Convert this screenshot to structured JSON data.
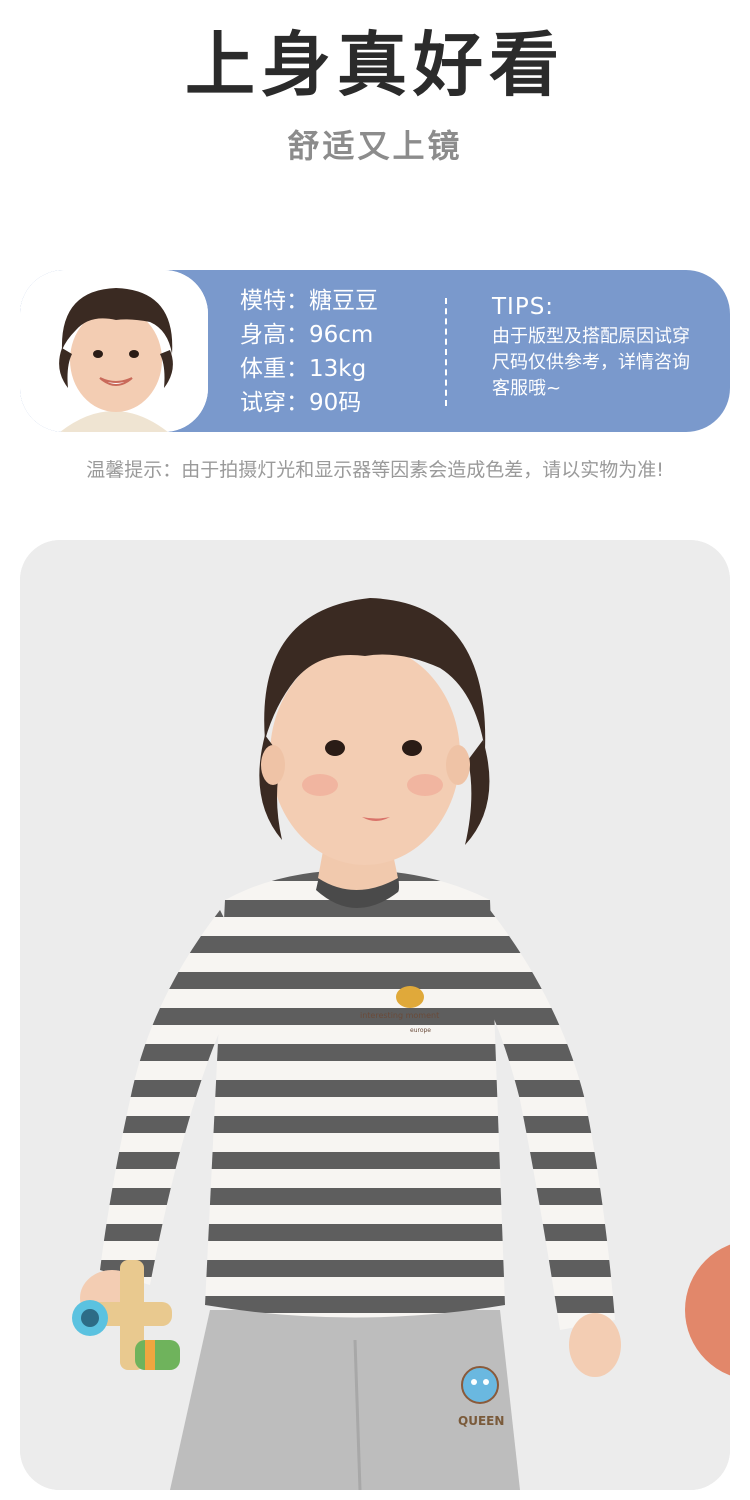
{
  "header": {
    "title": "上身真好看",
    "subtitle": "舒适又上镜"
  },
  "model_card": {
    "rows": [
      {
        "label": "模特：",
        "value": "糖豆豆"
      },
      {
        "label": "身高：",
        "value": "96cm"
      },
      {
        "label": "体重：",
        "value": "13kg"
      },
      {
        "label": "试穿：",
        "value": "90码"
      }
    ],
    "tips_title": "TIPS:",
    "tips_lines": [
      "由于版型及搭配原因试穿",
      "尺码仅供参考，详情咨询",
      "客服哦~"
    ]
  },
  "notice": "温馨提示：由于拍摄灯光和显示器等因素会造成色差，请以实物为准!",
  "product_photo": {
    "print_text": [
      "interesting moment",
      "europe"
    ],
    "badge_text": "QUEEN"
  },
  "colors": {
    "accent_blue": "#7a99cc",
    "stripe_dark": "#5e5e5e",
    "background_gray": "#ececec"
  }
}
